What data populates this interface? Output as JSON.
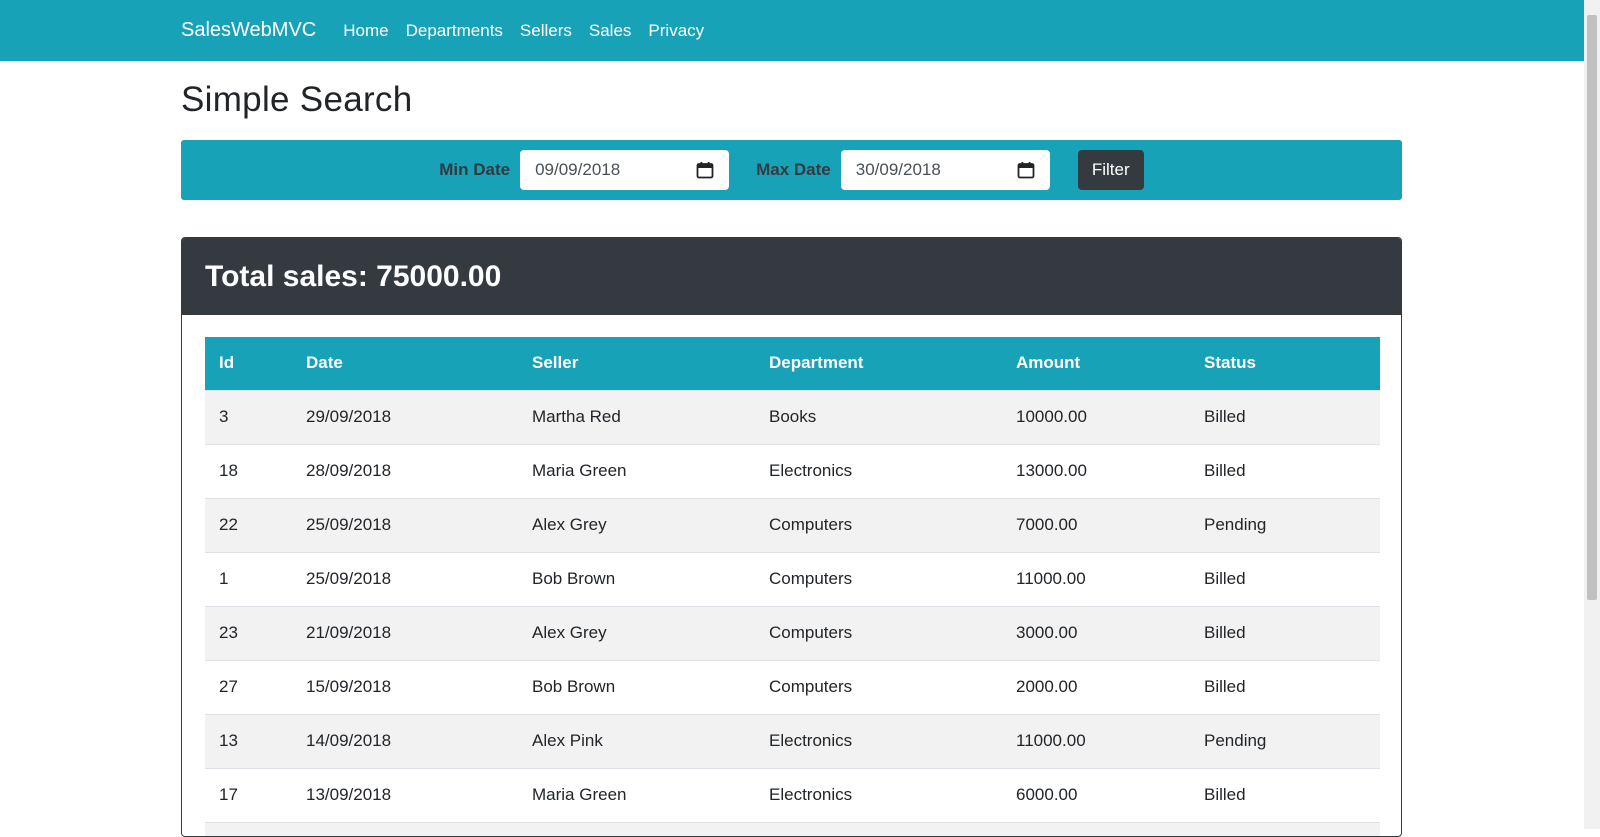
{
  "nav": {
    "brand": "SalesWebMVC",
    "links": [
      "Home",
      "Departments",
      "Sellers",
      "Sales",
      "Privacy"
    ]
  },
  "page": {
    "title": "Simple Search"
  },
  "filter": {
    "min_label": "Min Date",
    "min_value": "09/09/2018",
    "max_label": "Max Date",
    "max_value": "30/09/2018",
    "button_label": "Filter"
  },
  "summary": {
    "total_label": "Total sales: 75000.00"
  },
  "table": {
    "headers": [
      "Id",
      "Date",
      "Seller",
      "Department",
      "Amount",
      "Status"
    ],
    "rows": [
      [
        "3",
        "29/09/2018",
        "Martha Red",
        "Books",
        "10000.00",
        "Billed"
      ],
      [
        "18",
        "28/09/2018",
        "Maria Green",
        "Electronics",
        "13000.00",
        "Billed"
      ],
      [
        "22",
        "25/09/2018",
        "Alex Grey",
        "Computers",
        "7000.00",
        "Pending"
      ],
      [
        "1",
        "25/09/2018",
        "Bob Brown",
        "Computers",
        "11000.00",
        "Billed"
      ],
      [
        "23",
        "21/09/2018",
        "Alex Grey",
        "Computers",
        "3000.00",
        "Billed"
      ],
      [
        "27",
        "15/09/2018",
        "Bob Brown",
        "Computers",
        "2000.00",
        "Billed"
      ],
      [
        "13",
        "14/09/2018",
        "Alex Pink",
        "Electronics",
        "11000.00",
        "Pending"
      ],
      [
        "17",
        "13/09/2018",
        "Maria Green",
        "Electronics",
        "6000.00",
        "Billed"
      ],
      [
        "",
        "",
        "",
        "",
        "",
        ""
      ]
    ]
  },
  "colors": {
    "accent": "#17a2b8",
    "dark": "#343a40"
  },
  "icons": {
    "date_picker": "calendar-icon"
  }
}
